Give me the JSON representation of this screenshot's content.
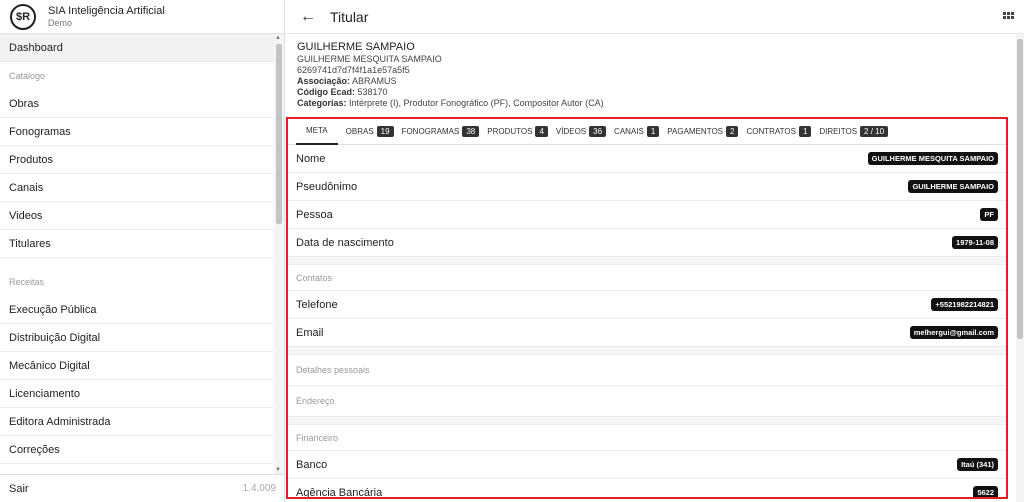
{
  "app": {
    "logo": "$R",
    "title": "SIA Inteligência Artificial",
    "subtitle": "Demo"
  },
  "sidebar": {
    "dashboard": "Dashboard",
    "catalog_label": "Catálogo",
    "catalog": [
      "Obras",
      "Fonogramas",
      "Produtos",
      "Canais",
      "Videos",
      "Titulares"
    ],
    "revenue_label": "Receitas",
    "revenue": [
      "Execução Pública",
      "Distribuição Digital",
      "Mecânico Digital",
      "Licenciamento",
      "Editora Administrada",
      "Correções"
    ],
    "logout": "Sair",
    "version": "1.4.009"
  },
  "header": {
    "back_icon": "arrow-left-icon",
    "title": "Titular",
    "menu_icon": "grid-icon"
  },
  "profile": {
    "name": "GUILHERME SAMPAIO",
    "full_name": "GUILHERME MESQUITA SAMPAIO",
    "id": "6269741d7d7f4f1a1e57a5f5",
    "association_label": "Associação:",
    "association": "ABRAMUS",
    "ecad_label": "Código Ecad:",
    "ecad": "538170",
    "categories_label": "Categorias:",
    "categories": "Intérprete (I), Produtor Fonográfico (PF), Compositor Autor (CA)"
  },
  "tabs": [
    {
      "label": "META",
      "badge": ""
    },
    {
      "label": "OBRAS",
      "badge": "19"
    },
    {
      "label": "FONOGRAMAS",
      "badge": "38"
    },
    {
      "label": "PRODUTOS",
      "badge": "4"
    },
    {
      "label": "VÍDEOS",
      "badge": "36"
    },
    {
      "label": "CANAIS",
      "badge": "1"
    },
    {
      "label": "PAGAMENTOS",
      "badge": "2"
    },
    {
      "label": "CONTRATOS",
      "badge": "1"
    },
    {
      "label": "DIREITOS",
      "badge": "2 / 10"
    }
  ],
  "meta": {
    "nome_label": "Nome",
    "nome": "GUILHERME MESQUITA SAMPAIO",
    "pseudonimo_label": "Pseudônimo",
    "pseudonimo": "GUILHERME SAMPAIO",
    "pessoa_label": "Pessoa",
    "pessoa": "PF",
    "nascimento_label": "Data de nascimento",
    "nascimento": "1979-11-08"
  },
  "contacts": {
    "label": "Contatos",
    "telefone_label": "Telefone",
    "telefone": "+5521982214821",
    "email_label": "Email",
    "email": "melhergui@gmail.com"
  },
  "personal": {
    "label": "Detalhes pessoais"
  },
  "address": {
    "label": "Endereço"
  },
  "financial": {
    "label": "Financeiro",
    "banco_label": "Banco",
    "banco": "Itaú (341)",
    "agencia_label": "Agência Bancária",
    "agencia": "5622"
  }
}
